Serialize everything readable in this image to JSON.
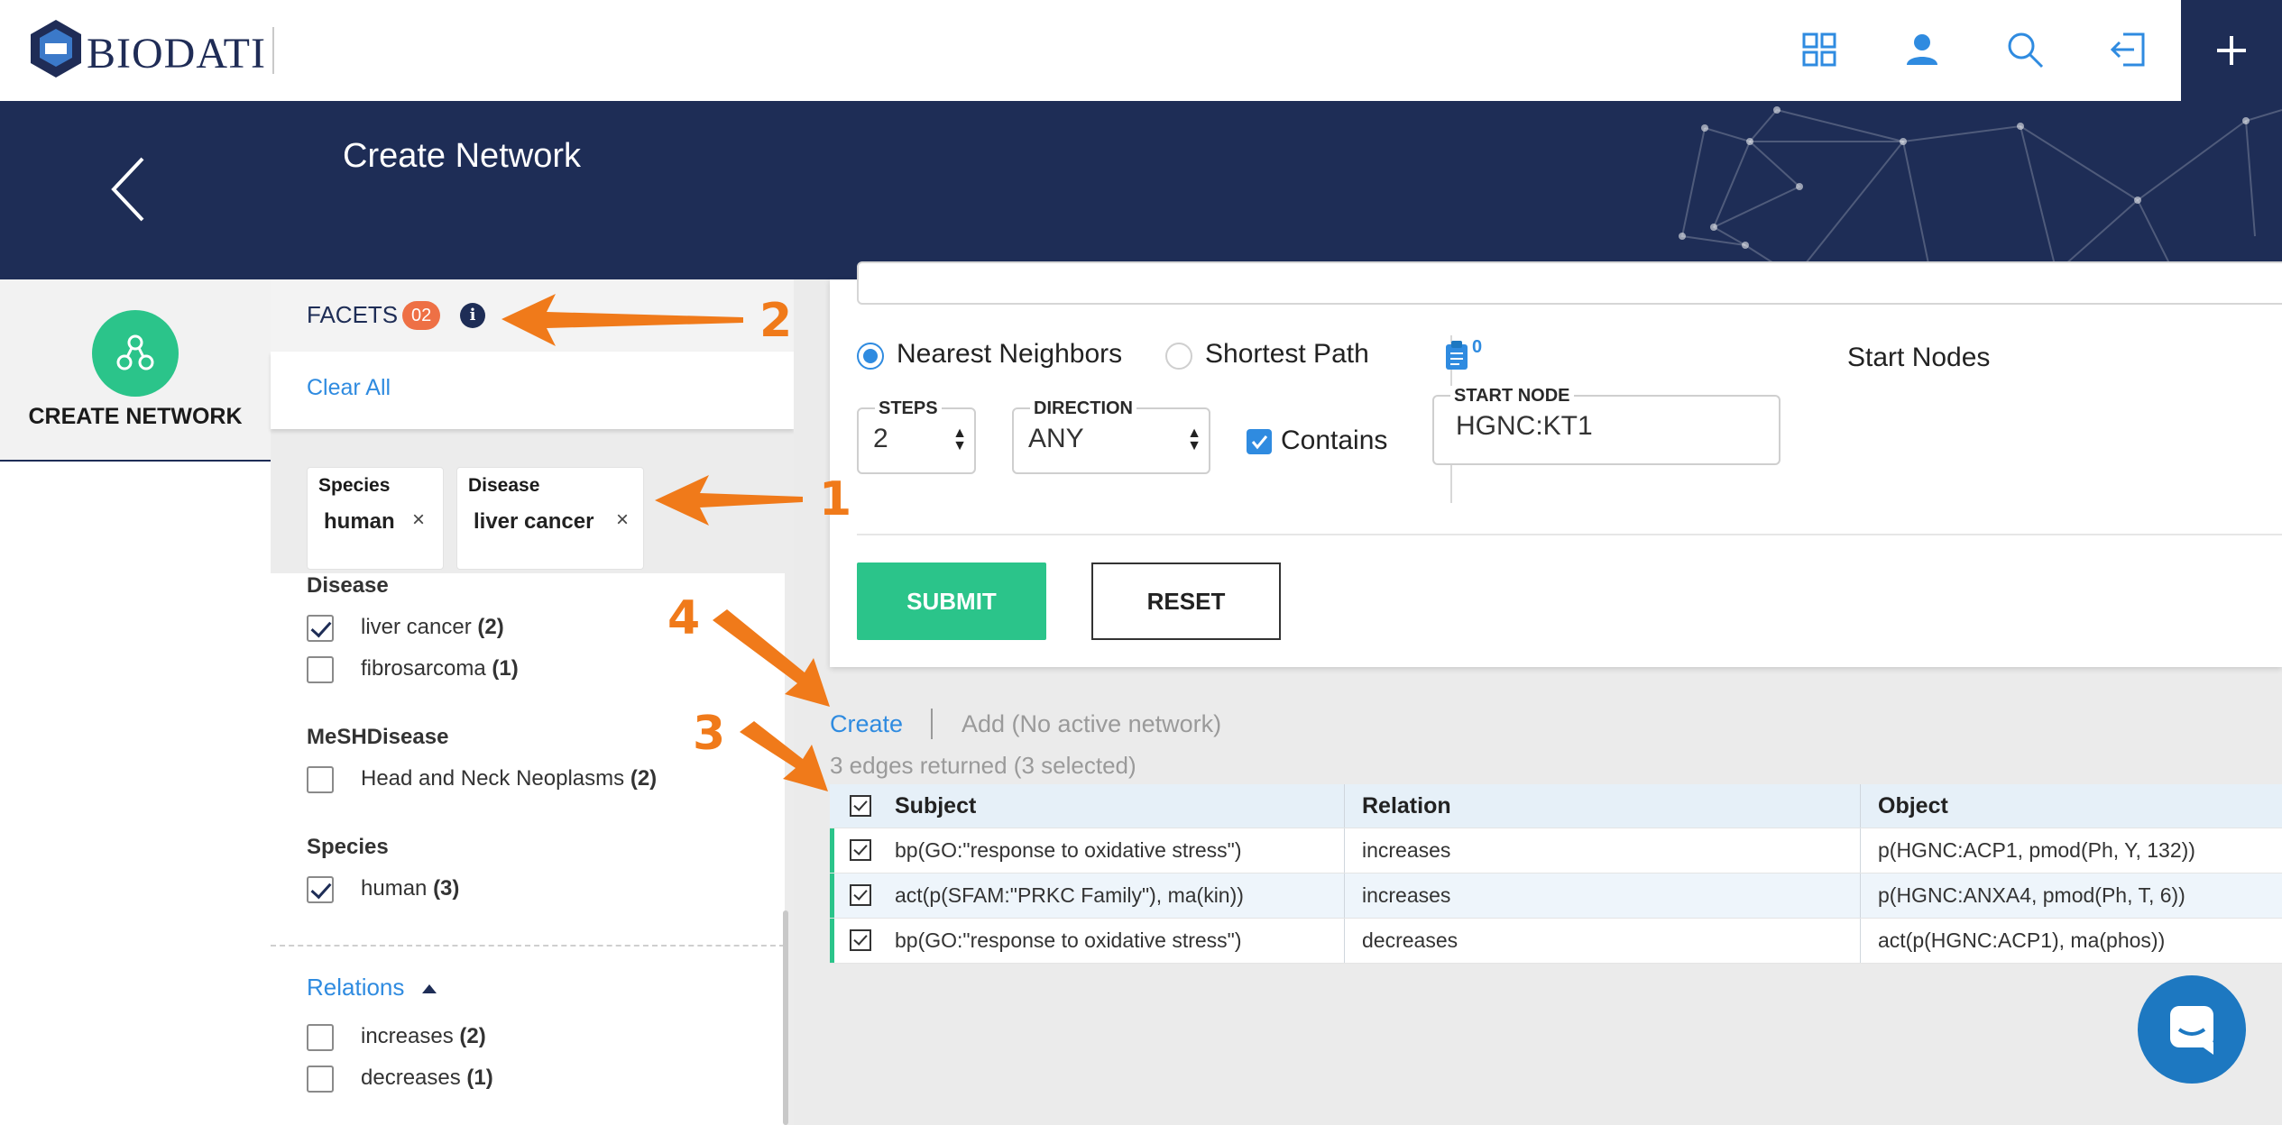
{
  "app": {
    "logo_text": "BIODATI"
  },
  "header": {
    "title": "Create Network"
  },
  "leftnav": {
    "active_label": "CREATE NETWORK"
  },
  "facets": {
    "title": "FACETS",
    "badge": "02",
    "info_glyph": "i",
    "clear_all": "Clear All",
    "chips": [
      {
        "label": "Species",
        "value": "human",
        "remove": "×"
      },
      {
        "label": "Disease",
        "value": "liver cancer",
        "remove": "×"
      }
    ],
    "groups": [
      {
        "title": "Disease",
        "options": [
          {
            "label": "liver cancer",
            "count": "(2)",
            "checked": true
          },
          {
            "label": "fibrosarcoma",
            "count": "(1)",
            "checked": false
          }
        ]
      },
      {
        "title": "MeSHDisease",
        "options": [
          {
            "label": "Head and Neck Neoplasms",
            "count": "(2)",
            "checked": false
          }
        ]
      },
      {
        "title": "Species",
        "options": [
          {
            "label": "human",
            "count": "(3)",
            "checked": true
          }
        ]
      }
    ],
    "relations": {
      "title": "Relations",
      "options": [
        {
          "label": "increases",
          "count": "(2)",
          "checked": false
        },
        {
          "label": "decreases",
          "count": "(1)",
          "checked": false
        }
      ]
    }
  },
  "form": {
    "modes": [
      {
        "label": "Nearest Neighbors",
        "selected": true
      },
      {
        "label": "Shortest Path",
        "selected": false
      }
    ],
    "steps": {
      "label": "STEPS",
      "value": "2"
    },
    "direction": {
      "label": "DIRECTION",
      "value": "ANY"
    },
    "contains": {
      "label": "Contains",
      "checked": true
    },
    "clipboard_count": "0",
    "start_node": {
      "label": "START NODE",
      "value": "HGNC:KT1"
    },
    "start_nodes_title": "Start Nodes",
    "submit": "SUBMIT",
    "reset": "RESET"
  },
  "results": {
    "create_link": "Create",
    "add_link": "Add (No active network)",
    "status": "3 edges returned (3 selected)",
    "columns": [
      "Subject",
      "Relation",
      "Object"
    ],
    "rows": [
      {
        "subject": "bp(GO:\"response to oxidative stress\")",
        "relation": "increases",
        "object": "p(HGNC:ACP1, pmod(Ph, Y, 132))",
        "checked": true
      },
      {
        "subject": "act(p(SFAM:\"PRKC Family\"), ma(kin))",
        "relation": "increases",
        "object": "p(HGNC:ANXA4, pmod(Ph, T, 6))",
        "checked": true
      },
      {
        "subject": "bp(GO:\"response to oxidative stress\")",
        "relation": "decreases",
        "object": "act(p(HGNC:ACP1), ma(phos))",
        "checked": true
      }
    ]
  },
  "annotations": {
    "n1": "1",
    "n2": "2",
    "n3": "3",
    "n4": "4"
  },
  "icons": [
    "apps-grid-icon",
    "user-icon",
    "search-icon",
    "logout-icon",
    "plus-icon",
    "back-arrow-icon",
    "network-icon",
    "clipboard-icon",
    "chat-icon",
    "caret-up-icon"
  ],
  "colors": {
    "navy": "#1e2d56",
    "green": "#2bc48a",
    "blue": "#2f8be0",
    "orange": "#f07a1a",
    "badge": "#ee7045"
  }
}
